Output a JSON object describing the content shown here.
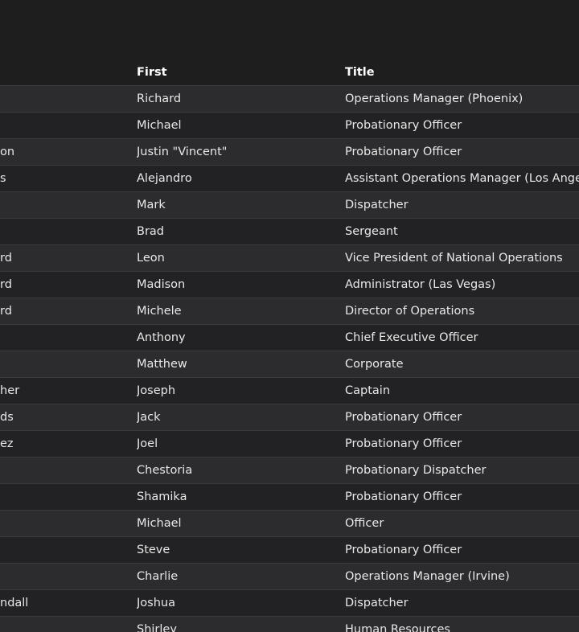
{
  "table": {
    "columns": {
      "last": "",
      "first": "First",
      "title": "Title"
    },
    "rows": [
      {
        "last": "",
        "first": "Richard",
        "title": "Operations Manager (Phoenix)"
      },
      {
        "last": "",
        "first": "Michael",
        "title": "Probationary Officer"
      },
      {
        "last": "on",
        "first": "Justin \"Vincent\"",
        "title": "Probationary Officer"
      },
      {
        "last": "s",
        "first": "Alejandro",
        "title": "Assistant Operations Manager (Los Angele"
      },
      {
        "last": "",
        "first": "Mark",
        "title": "Dispatcher"
      },
      {
        "last": "",
        "first": "Brad",
        "title": "Sergeant"
      },
      {
        "last": "rd",
        "first": "Leon",
        "title": "Vice President of National Operations"
      },
      {
        "last": "rd",
        "first": "Madison",
        "title": "Administrator (Las Vegas)"
      },
      {
        "last": "rd",
        "first": "Michele",
        "title": "Director of Operations"
      },
      {
        "last": "",
        "first": "Anthony",
        "title": "Chief Executive Officer"
      },
      {
        "last": "",
        "first": "Matthew",
        "title": "Corporate"
      },
      {
        "last": "her",
        "first": "Joseph",
        "title": "Captain"
      },
      {
        "last": "ds",
        "first": "Jack",
        "title": "Probationary Officer"
      },
      {
        "last": "ez",
        "first": "Joel",
        "title": "Probationary Officer"
      },
      {
        "last": "",
        "first": "Chestoria",
        "title": "Probationary Dispatcher"
      },
      {
        "last": "",
        "first": "Shamika",
        "title": "Probationary Officer"
      },
      {
        "last": "",
        "first": "Michael",
        "title": "Officer"
      },
      {
        "last": "",
        "first": "Steve",
        "title": "Probationary Officer"
      },
      {
        "last": "",
        "first": "Charlie",
        "title": "Operations Manager (Irvine)"
      },
      {
        "last": "ndall",
        "first": "Joshua",
        "title": "Dispatcher"
      },
      {
        "last": "",
        "first": "Shirley",
        "title": "Human Resources"
      }
    ]
  }
}
